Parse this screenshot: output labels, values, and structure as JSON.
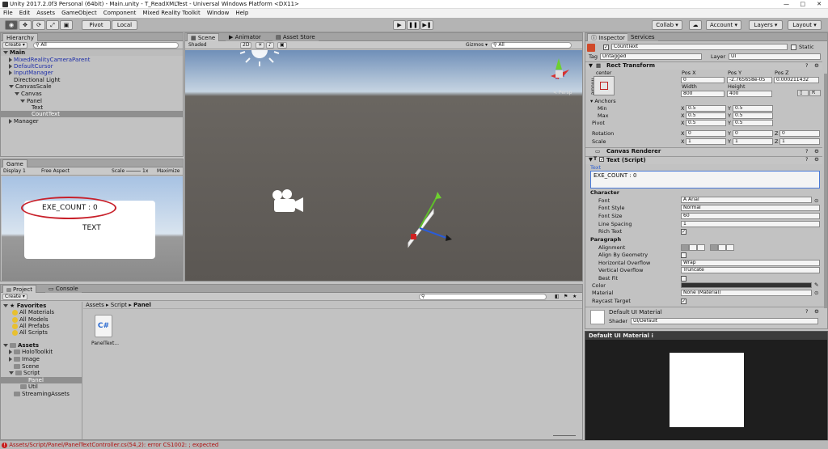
{
  "window": {
    "title": "Unity 2017.2.0f3 Personal (64bit) - Main.unity - T_ReadXMLTest - Universal Windows Platform <DX11>",
    "min": "—",
    "max": "□",
    "close": "✕"
  },
  "menu": [
    "File",
    "Edit",
    "Assets",
    "GameObject",
    "Component",
    "Mixed Reality Toolkit",
    "Window",
    "Help"
  ],
  "toolbar": {
    "pivot": "Pivot",
    "local": "Local",
    "collab": "Collab ▾",
    "account": "Account ▾",
    "layers": "Layers ▾",
    "layout": "Layout ▾",
    "cloud": "☁"
  },
  "hierarchy": {
    "tab": "Hierarchy",
    "create": "Create ▾",
    "search": "All",
    "scene": "Main",
    "items": [
      {
        "label": "MixedRealityCameraParent",
        "blue": true
      },
      {
        "label": "DefaultCursor",
        "blue": true
      },
      {
        "label": "InputManager",
        "blue": true
      },
      {
        "label": "Directional Light"
      },
      {
        "label": "CanvasScale"
      },
      {
        "label": "Canvas"
      },
      {
        "label": "Panel"
      },
      {
        "label": "Text"
      },
      {
        "label": "CountText"
      },
      {
        "label": "Manager"
      }
    ]
  },
  "scene": {
    "tabs": [
      "Scene",
      "Animator",
      "Asset Store"
    ],
    "shaded": "Shaded",
    "mode2d": "2D",
    "gizmos": "Gizmos ▾",
    "search": "All",
    "persp": "< Persp"
  },
  "game": {
    "tab": "Game",
    "display": "Display 1",
    "aspect": "Free Aspect",
    "scale": "Scale",
    "scale_val": "1x",
    "maximize": "Maximize O",
    "count_text": "EXE_COUNT : 0",
    "text_label": "TEXT"
  },
  "project": {
    "tabs": [
      "Project",
      "Console"
    ],
    "create": "Create ▾",
    "breadcrumb": [
      "Assets",
      "Script",
      "Panel"
    ],
    "favorites": "Favorites",
    "fav_items": [
      "All Materials",
      "All Models",
      "All Prefabs",
      "All Scripts"
    ],
    "assets": "Assets",
    "asset_items": [
      "HoloToolkit",
      "Image",
      "Scene",
      "Script",
      "Panel",
      "Util",
      "StreamingAssets"
    ],
    "file_name": "PanelText...",
    "file_icon": "C#"
  },
  "inspector": {
    "tabs": [
      "Inspector",
      "Services"
    ],
    "object_name": "CountText",
    "static": "Static",
    "tag_label": "Tag",
    "tag": "Untagged",
    "layer_label": "Layer",
    "layer": "UI",
    "rect": {
      "title": "Rect Transform",
      "anchor": "center",
      "side": "middle",
      "pos_x_label": "Pos X",
      "pos_y_label": "Pos Y",
      "pos_z_label": "Pos Z",
      "pos_x": "0",
      "pos_y": "-2.765658e-05",
      "pos_z": "0.000211432",
      "width_label": "Width",
      "height_label": "Height",
      "width": "800",
      "height": "400",
      "anchors": "Anchors",
      "min": "Min",
      "max": "Max",
      "pivot": "Pivot",
      "min_x": "0.5",
      "min_y": "0.5",
      "max_x": "0.5",
      "max_y": "0.5",
      "pivot_x": "0.5",
      "pivot_y": "0.5",
      "rotation": "Rotation",
      "rot_x": "0",
      "rot_y": "0",
      "rot_z": "0",
      "scale": "Scale",
      "sc_x": "1",
      "sc_y": "1",
      "sc_z": "1",
      "btn": "R"
    },
    "canvas_renderer": "Canvas Renderer",
    "text_script": {
      "title": "Text (Script)",
      "text_label": "Text",
      "text_value": "EXE_COUNT : 0",
      "character": "Character",
      "font": "Font",
      "font_val": "Arial",
      "font_style": "Font Style",
      "font_style_val": "Normal",
      "font_size": "Font Size",
      "font_size_val": "60",
      "line_spacing": "Line Spacing",
      "line_spacing_val": "1",
      "rich_text": "Rich Text",
      "paragraph": "Paragraph",
      "alignment": "Alignment",
      "align_geom": "Align By Geometry",
      "h_overflow": "Horizontal Overflow",
      "h_overflow_val": "Wrap",
      "v_overflow": "Vertical Overflow",
      "v_overflow_val": "Truncate",
      "best_fit": "Best Fit",
      "color": "Color",
      "material": "Material",
      "material_val": "None (Material)",
      "raycast": "Raycast Target"
    },
    "material": {
      "name": "Default UI Material",
      "shader_label": "Shader",
      "shader": "UI/Default"
    },
    "preview_title": "Default UI Material ⁝"
  },
  "status": {
    "error": "Assets/Script/Panel/PanelTextController.cs(54,2): error CS1002: ; expected"
  }
}
